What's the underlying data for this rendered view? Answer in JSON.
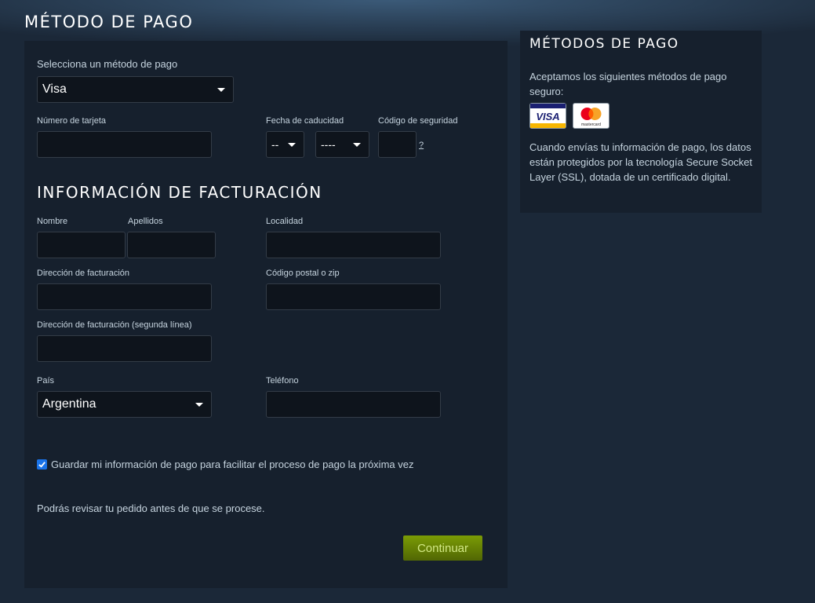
{
  "page_title": "MÉTODO DE PAGO",
  "payment": {
    "select_label": "Selecciona un método de pago",
    "method_value": "Visa",
    "card_number_label": "Número de tarjeta",
    "expiry_label": "Fecha de caducidad",
    "expiry_month": "--",
    "expiry_year": "----",
    "security_label": "Código de seguridad",
    "help_link": "?"
  },
  "billing": {
    "title": "INFORMACIÓN DE FACTURACIÓN",
    "first_name_label": "Nombre",
    "last_name_label": "Apellidos",
    "city_label": "Localidad",
    "address_label": "Dirección de facturación",
    "zip_label": "Código postal o zip",
    "address2_label": "Dirección de facturación (segunda línea)",
    "country_label": "País",
    "country_value": "Argentina",
    "phone_label": "Teléfono"
  },
  "save_checkbox": {
    "checked": true,
    "label": "Guardar mi información de pago para facilitar el proceso de pago la próxima vez"
  },
  "note": "Podrás revisar tu pedido antes de que se procese.",
  "continue_button": "Continuar",
  "sidebar": {
    "title": "MÉTODOS DE PAGO",
    "intro": "Aceptamos los siguientes métodos de pago seguro:",
    "cards": [
      {
        "name": "VISA",
        "icon": "visa-card-icon"
      },
      {
        "name": "mastercard",
        "icon": "mastercard-icon"
      }
    ],
    "security_text": "Cuando envías tu información de pago, los datos están protegidos por la tecnología Secure Socket Layer (SSL), dotada de un certificado digital."
  },
  "colors": {
    "background": "#1b2838",
    "panel": "#16202d",
    "accent_button": "#799905"
  }
}
